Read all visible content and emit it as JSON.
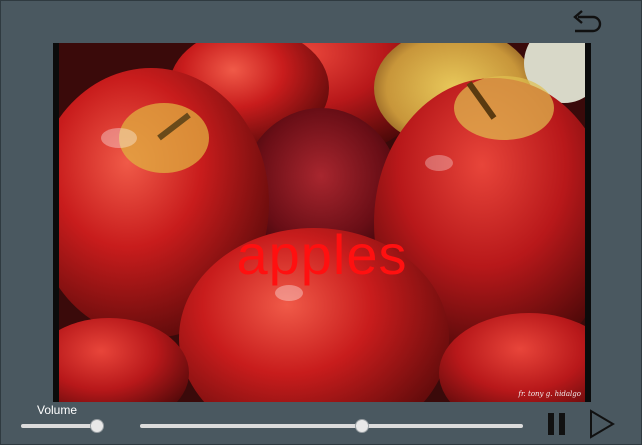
{
  "player": {
    "back_icon": "back-arrow-icon",
    "overlay_word": "apples",
    "photo_credit": "fr. tony g. hidalgo",
    "volume_label": "Volume",
    "volume_level": 0.95,
    "seek_position": 0.58,
    "pause_icon": "pause-icon",
    "play_icon": "play-icon",
    "colors": {
      "background": "#4a5860",
      "overlay_text": "#ff1010"
    }
  }
}
